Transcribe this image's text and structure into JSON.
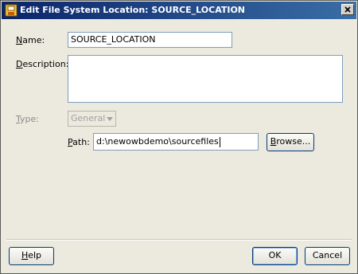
{
  "window": {
    "title": "Edit File System Location: SOURCE_LOCATION",
    "icon": "folder-app-icon",
    "close_label": "×"
  },
  "form": {
    "name_label_mn": "N",
    "name_label_rest": "ame:",
    "name_value": "SOURCE_LOCATION",
    "description_label_mn": "D",
    "description_label_rest": "escription:",
    "description_value": "",
    "type_label_mn": "T",
    "type_label_rest": "ype:",
    "type_value": "General",
    "path_label_mn": "P",
    "path_label_rest": "ath:",
    "path_value": "d:\\newowbdemo\\sourcefiles",
    "browse_label_mn": "B",
    "browse_label_rest": "rowse..."
  },
  "footer": {
    "help_label_mn": "H",
    "help_label_rest": "elp",
    "ok_label": "OK",
    "cancel_label": "Cancel"
  },
  "colors": {
    "titlebar_start": "#0a246a",
    "titlebar_end": "#3a6ea5",
    "dialog_bg": "#eceadf",
    "field_border": "#7f9db9",
    "button_border": "#003c74"
  }
}
